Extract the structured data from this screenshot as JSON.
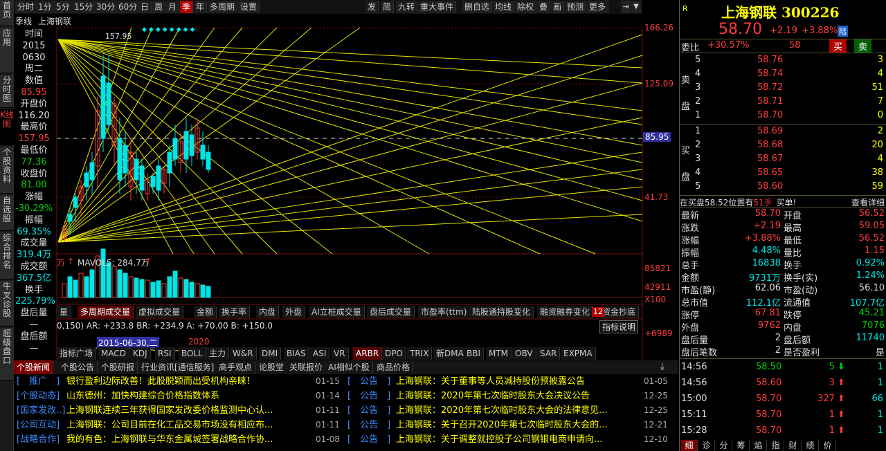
{
  "leftnav": [
    "首页",
    "应用",
    "分时图",
    "K线图",
    "个股资料",
    "自选股",
    "综合排名",
    "牛叉诊股",
    "超级盘口"
  ],
  "toolbar_left": [
    "分时",
    "1分",
    "5分",
    "15分",
    "30分",
    "60分",
    "日",
    "周",
    "月",
    "季",
    "年",
    "多周期",
    "设置"
  ],
  "toolbar_right": [
    "发",
    "简",
    "九转",
    "重大事件",
    "删自选",
    "均线",
    "除权",
    "叠",
    "画",
    "预测",
    "更多"
  ],
  "chart": {
    "period": "季线",
    "name": "上海钢联",
    "high_label": "157.95",
    "y_ticks": [
      "166.26",
      "125.09",
      "41.73"
    ],
    "price_badge": "85.95",
    "event_marks": "◆◆◆◆◆◆◆◆",
    "vol_label": "MAVOL5: 284.7万",
    "vol_ticks": [
      "85821",
      "42911",
      "X100"
    ],
    "vol_unit": "万",
    "ind_title": "0,150)  AR: +233.8  BR: +234.9  A: +70.00  B: +150.0",
    "ind_tick": "+6989",
    "ind_explain": "指标说明",
    "date_label": "2015-06-30,二",
    "year_label": "2020"
  },
  "infobox": {
    "time_lbl": "时间",
    "year": "2015",
    "md": "0630",
    "wd": "周二",
    "val_lbl": "数值",
    "val": "85.95",
    "open_lbl": "开盘价",
    "open": "116.20",
    "high_lbl": "最高价",
    "high": "157.95",
    "low_lbl": "最低价",
    "low": "77.36",
    "close_lbl": "收盘价",
    "close": "81.00",
    "chg_lbl": "涨幅",
    "chg": "-30.29%",
    "amp_lbl": "振幅",
    "amp": "69.35%",
    "vol_lbl": "成交量",
    "vol": "319.4万",
    "amt_lbl": "成交额",
    "amt": "367.5亿",
    "turn_lbl": "换手",
    "turn": "225.79%",
    "after_lbl": "盘后量",
    "after": "—",
    "afteramt_lbl": "盘后额",
    "afteramt": "—"
  },
  "midtabs": [
    "量",
    "多周期成交量",
    "虚拟成交量",
    "金额",
    "换手率",
    "内盘",
    "外盘",
    "AI立桩成交量",
    "盘后成交量",
    "市盈率(ttm)",
    "陆股通持股变化",
    "融资融券变化",
    "资金抄底"
  ],
  "indtabs": [
    "指标广场",
    "MACD",
    "KDJ",
    "RSI",
    "BOLL",
    "主力",
    "W&R",
    "DMI",
    "BIAS",
    "ASI",
    "VR",
    "ARBR",
    "DPO",
    "TRIX",
    "新DMA",
    "BBI",
    "MTM",
    "OBV",
    "SAR",
    "EXPMA"
  ],
  "newstabs": [
    "个股新闻",
    "个股公告",
    "个股研报",
    "行业资讯[通信服务]",
    "高手观点",
    "论股堂",
    "关联报价",
    "AI相似个股",
    "商品价格"
  ],
  "news_left": [
    {
      "tag": "[　推广　]",
      "title": "银行盈利边际改善！此股脱颖而出受机构亲睐！",
      "date": "01-15"
    },
    {
      "tag": "[个股动态]",
      "title": "山东德州：加快构建综合价格指数体系",
      "date": "01-14"
    },
    {
      "tag": "[国家发改..]",
      "title": "上海钢联连续三年获得国家发改委价格监测中心认...",
      "date": "01-11"
    },
    {
      "tag": "[公司互动]",
      "title": "上海钢联：公司目前在化工品交易市场没有相应布...",
      "date": "01-11"
    },
    {
      "tag": "[战略合作]",
      "title": "我的有色：上海钢联与华东金属城签署战略合作协...",
      "date": "01-08"
    }
  ],
  "news_right": [
    {
      "tag": "[　公告　]",
      "title": "上海钢联：关于董事等人员减持股份预披露公告",
      "date": "01-05"
    },
    {
      "tag": "[　公告　]",
      "title": "上海钢联：2020年第七次临时股东大会决议公告",
      "date": "12-25"
    },
    {
      "tag": "[　公告　]",
      "title": "上海钢联：2020年第七次临时股东大会的法律意见...",
      "date": "12-25"
    },
    {
      "tag": "[　公告　]",
      "title": "上海钢联：关于召开2020年第七次临时股东大会的...",
      "date": "12-21"
    },
    {
      "tag": "[　公告　]",
      "title": "上海钢联：关于调整就控股子公司钢银电商申请向...",
      "date": "12-10"
    }
  ],
  "quote": {
    "r": "R",
    "name": "上海钢联 300226",
    "price": "58.70",
    "chg": "+2.19",
    "pct": "+3.88%",
    "lu": "陆",
    "wb_lbl": "委比",
    "wb": "+30.57%",
    "wb_n": "58",
    "sell_btn": "买",
    "buy_btn": "卖",
    "sell_lbl": "卖盘",
    "buy_lbl": "买盘",
    "asks": [
      {
        "l": "5",
        "p": "58.76",
        "v": "3"
      },
      {
        "l": "4",
        "p": "58.74",
        "v": "4"
      },
      {
        "l": "3",
        "p": "58.72",
        "v": "51"
      },
      {
        "l": "2",
        "p": "58.71",
        "v": "7"
      },
      {
        "l": "1",
        "p": "58.70",
        "v": "0"
      }
    ],
    "bids": [
      {
        "l": "1",
        "p": "58.69",
        "v": "2"
      },
      {
        "l": "2",
        "p": "58.68",
        "v": "20"
      },
      {
        "l": "3",
        "p": "58.67",
        "v": "4"
      },
      {
        "l": "4",
        "p": "58.65",
        "v": "38"
      },
      {
        "l": "5",
        "p": "58.60",
        "v": "59"
      }
    ],
    "msg": "在买盘58.52位置有",
    "msg_n": "51手",
    "msg_b": "买单!",
    "detail": "查看详细",
    "stats": [
      {
        "a": "最新",
        "av": "58.70",
        "ac": "r",
        "b": "开盘",
        "bv": "56.52",
        "bc": "r"
      },
      {
        "a": "涨跌",
        "av": "+2.19",
        "ac": "r",
        "b": "最高",
        "bv": "59.05",
        "bc": "r"
      },
      {
        "a": "涨幅",
        "av": "+3.88%",
        "ac": "r",
        "b": "最低",
        "bv": "56.52",
        "bc": "r"
      },
      {
        "a": "振幅",
        "av": "4.48%",
        "ac": "c",
        "b": "量比",
        "bv": "1.15",
        "bc": "r"
      },
      {
        "a": "总手",
        "av": "16838",
        "ac": "c",
        "b": "换手",
        "bv": "0.92%",
        "bc": "c"
      },
      {
        "a": "金额",
        "av": "9731万",
        "ac": "c",
        "b": "换手(实)",
        "bv": "1.24%",
        "bc": "c"
      },
      {
        "a": "市盈(静)",
        "av": "62.06",
        "ac": "w",
        "b": "市盈(动)",
        "bv": "56.10",
        "bc": "w"
      },
      {
        "a": "总市值",
        "av": "112.1亿",
        "ac": "c",
        "b": "流通值",
        "bv": "107.7亿",
        "bc": "c"
      },
      {
        "a": "涨停",
        "av": "67.81",
        "ac": "r",
        "b": "跌停",
        "bv": "45.21",
        "bc": "g"
      },
      {
        "a": "外盘",
        "av": "9762",
        "ac": "r",
        "b": "内盘",
        "bv": "7076",
        "bc": "g"
      },
      {
        "a": "盘后量",
        "av": "2",
        "ac": "w",
        "b": "盘后额",
        "bv": "11740",
        "bc": "c"
      },
      {
        "a": "盘后笔数",
        "av": "2",
        "ac": "w",
        "b": "是否盈利",
        "bv": "是",
        "bc": "w"
      }
    ],
    "ticks": [
      {
        "t": "14:56",
        "p": "58.50",
        "v": "5",
        "d": "down",
        "n": "1"
      },
      {
        "t": "14:56",
        "p": "58.60",
        "v": "3",
        "d": "up",
        "n": "1"
      },
      {
        "t": "15:00",
        "p": "58.70",
        "v": "327",
        "d": "up",
        "n": "66"
      },
      {
        "t": "15:11",
        "p": "58.70",
        "v": "1",
        "d": "up",
        "n": "1"
      },
      {
        "t": "15:28",
        "p": "58.70",
        "v": "1",
        "d": "up",
        "n": "1"
      }
    ],
    "bottomtabs": [
      "细",
      "诊",
      "分",
      "筹",
      "焰",
      "指",
      "财",
      "绩",
      "价"
    ]
  }
}
